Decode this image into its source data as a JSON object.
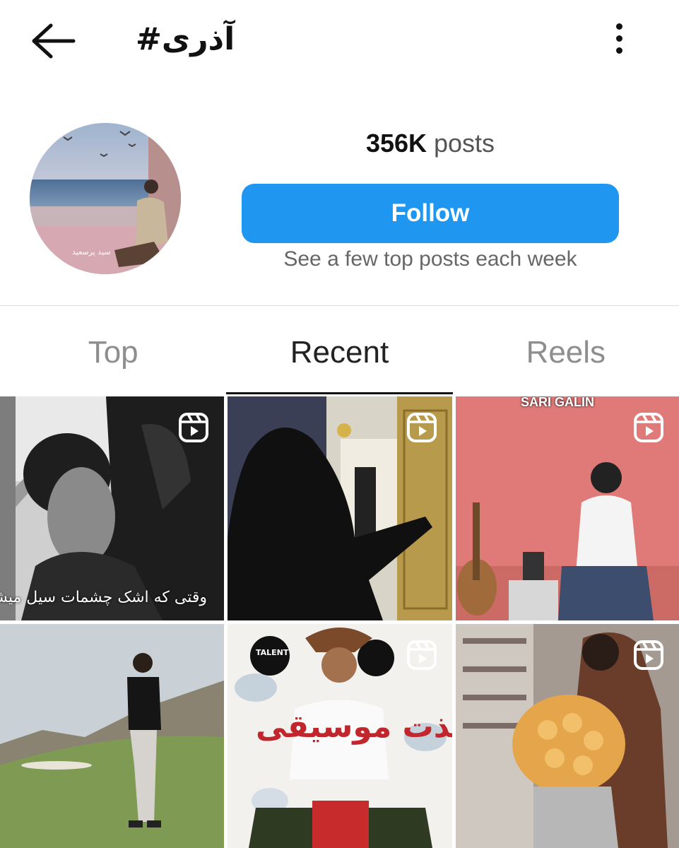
{
  "header": {
    "title": "#آذری",
    "back_icon": "arrow-left-icon",
    "menu_icon": "more-vertical-icon"
  },
  "profile": {
    "avatar_signature": "سید پرسعید",
    "posts_count": "356K",
    "posts_label": "posts",
    "follow_label": "Follow",
    "subtitle": "See a few top posts each week",
    "accent_color": "#1f97f1"
  },
  "tabs": [
    {
      "label": "Top",
      "active": false
    },
    {
      "label": "Recent",
      "active": true
    },
    {
      "label": "Reels",
      "active": false
    }
  ],
  "grid": {
    "posts": [
      {
        "type": "reel",
        "caption": "وقتی که اشک چشمات سیل میشه"
      },
      {
        "type": "reel",
        "caption": ""
      },
      {
        "type": "reel",
        "caption": "SARI GALIN"
      },
      {
        "type": "image",
        "caption": ""
      },
      {
        "type": "reel",
        "caption": "شادی و لذت موسیقی",
        "badge": "TALENT"
      },
      {
        "type": "reel",
        "caption": ""
      }
    ]
  }
}
